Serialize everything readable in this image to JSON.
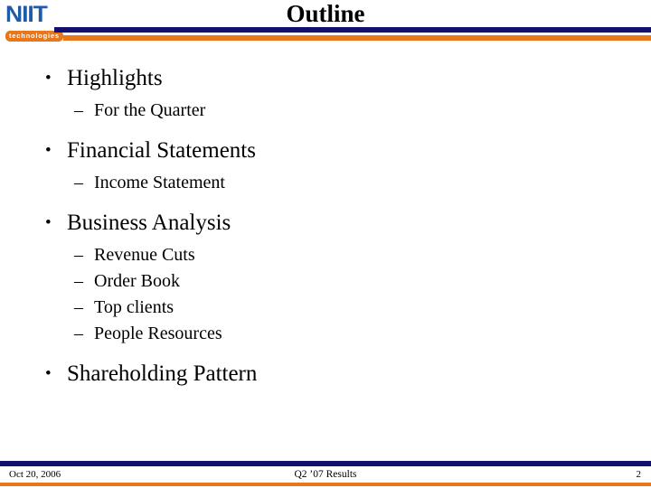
{
  "slide": {
    "title": "Outline",
    "brand": {
      "logo_word": "NIIT",
      "logo_tagline": "technologies",
      "logo_blue": "#1f5ba8",
      "accent_orange": "#e8761a",
      "accent_navy": "#11106e"
    },
    "content": [
      {
        "level": 1,
        "marker": "•",
        "text": "Highlights"
      },
      {
        "level": 2,
        "marker": "–",
        "text": "For the Quarter"
      },
      {
        "level": 1,
        "marker": "•",
        "text": "Financial Statements"
      },
      {
        "level": 2,
        "marker": "–",
        "text": "Income Statement"
      },
      {
        "level": 1,
        "marker": "•",
        "text": "Business Analysis"
      },
      {
        "level": 2,
        "marker": "–",
        "text": "Revenue Cuts"
      },
      {
        "level": 2,
        "marker": "–",
        "text": "Order Book"
      },
      {
        "level": 2,
        "marker": "–",
        "text": "Top clients"
      },
      {
        "level": 2,
        "marker": "–",
        "text": "People Resources"
      },
      {
        "level": 1,
        "marker": "•",
        "text": "Shareholding Pattern"
      }
    ],
    "footer": {
      "date": "Oct 20, 2006",
      "center": "Q2 ’07 Results",
      "page_number": "2"
    }
  }
}
